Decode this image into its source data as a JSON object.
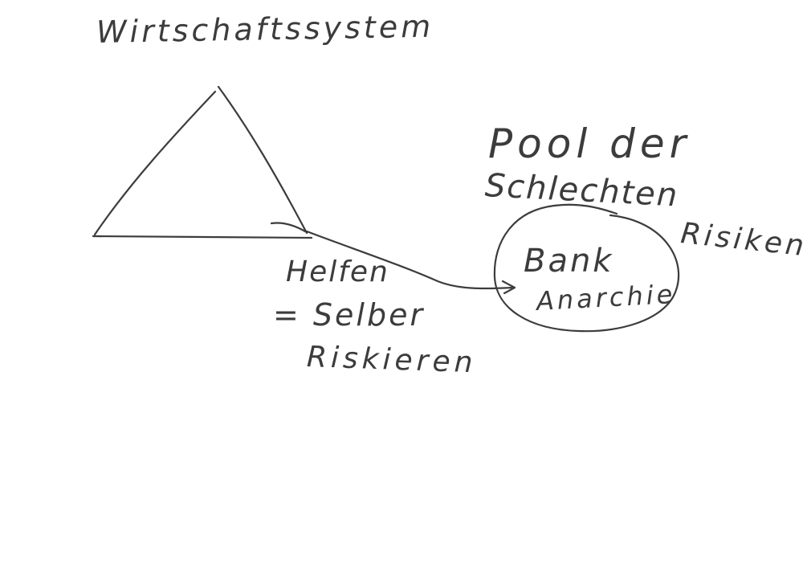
{
  "title": "Wirtschaftssystem",
  "pool": {
    "line1": "Pool der",
    "line2": "Schlechten",
    "line3": "Risiken"
  },
  "bank": {
    "line1": "Bank",
    "line2": "Anarchie"
  },
  "help": {
    "line1": "Helfen",
    "line2": "= Selber",
    "line3": "Riskieren"
  },
  "ink_color": "#3c3c3c",
  "background_color": "#ffffff"
}
